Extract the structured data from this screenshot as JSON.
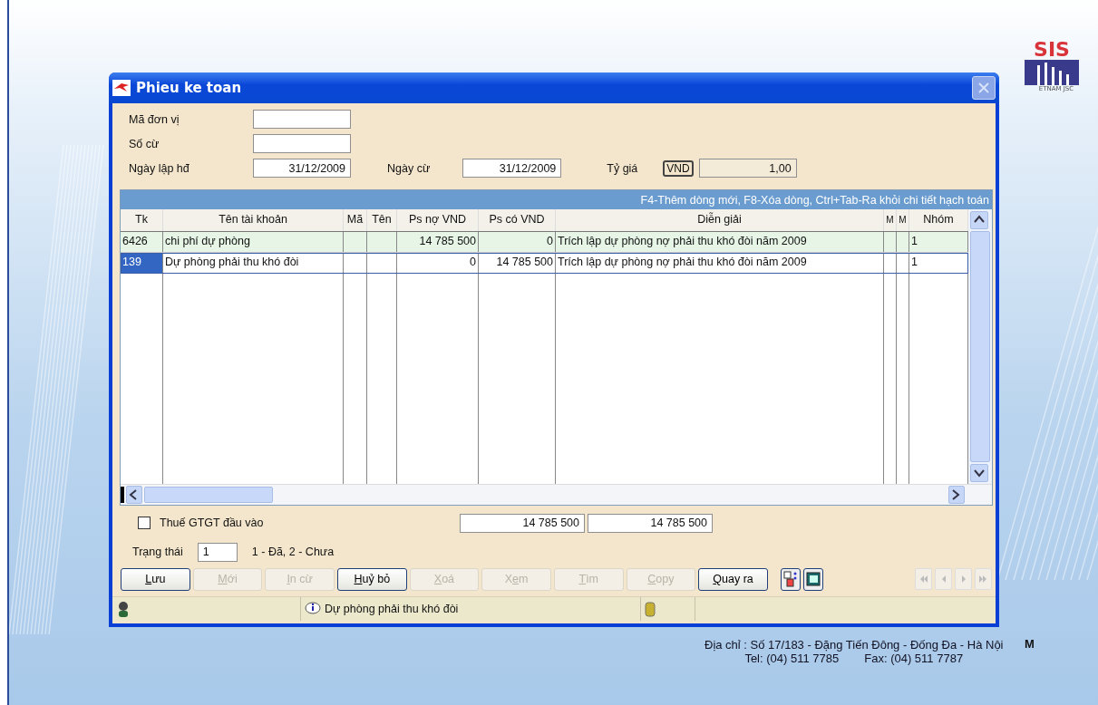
{
  "logo": {
    "name": "SIS",
    "tagline": "ETNAM JSC",
    "cut_text": "M"
  },
  "window": {
    "title": "Phieu ke toan"
  },
  "form": {
    "fields": [
      {
        "label": "Mã đơn vị"
      },
      {
        "label": "Số cừ"
      }
    ],
    "date_row": {
      "created_label": "Ngày lập hđ",
      "created": "31/12/2009",
      "doc_label": "Ngày cừ",
      "doc": "31/12/2009",
      "rate_label": "Tỷ giá",
      "currency": "VND",
      "rate": "1,00"
    }
  },
  "table": {
    "hint": "F4-Thêm dòng mới, F8-Xóa dòng, Ctrl+Tab-Ra khỏi chi tiết hạch toán",
    "columns": [
      "Tk",
      "Tên tài khoản",
      "Mã",
      "Tên",
      "Ps nợ VND",
      "Ps có VND",
      "Diễn giải",
      "M",
      "M",
      "Nhóm"
    ],
    "rows": [
      {
        "selected": false,
        "cells": [
          "6426",
          "chi phí dự phòng",
          "",
          "",
          "14 785 500",
          "0",
          "Trích lập dự phòng nợ phải thu khó đòi năm 2009",
          "",
          "",
          "1"
        ]
      },
      {
        "selected": true,
        "cells": [
          "139",
          "Dự phòng phải thu khó đòi",
          "",
          "",
          "0",
          "14 785 500",
          "Trích lập dự phòng nợ phải thu khó đòi năm 2009",
          "",
          "",
          "1"
        ]
      }
    ]
  },
  "vat": {
    "label": "Thuế GTGT đầu vào",
    "checked": false
  },
  "totals": [
    "14 785 500",
    "14 785 500"
  ],
  "status": {
    "label": "Trạng thái",
    "value": "1",
    "legend": "1 - Đã, 2 - Chưa"
  },
  "buttons": [
    {
      "key": "L",
      "after": "ưu",
      "disabled": false
    },
    {
      "key": "M",
      "after": "ới",
      "disabled": true
    },
    {
      "key": "I",
      "after": "n cừ",
      "disabled": true
    },
    {
      "key": "H",
      "after": "uỷ bỏ",
      "disabled": false
    },
    {
      "key": "X",
      "after": "oá",
      "disabled": true
    },
    {
      "before": "X",
      "key": "e",
      "after": "m",
      "disabled": true
    },
    {
      "key": "T",
      "after": "ìm",
      "disabled": true
    },
    {
      "key": "C",
      "after": "opy",
      "disabled": true
    },
    {
      "key": "Q",
      "after": "uay ra",
      "disabled": false
    }
  ],
  "status_bar": {
    "message": "Dự phòng phải thu khó đòi"
  },
  "footer": {
    "address": "Địa chỉ : Số 17/183 - Đặng Tiến Đông - Đống Đa - Hà Nội",
    "phone": "Tel: (04) 511 7785",
    "fax": "Fax: (04) 511 7787"
  }
}
